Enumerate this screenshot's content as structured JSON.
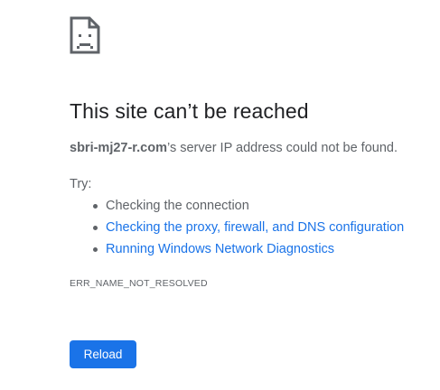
{
  "error": {
    "icon": "sad-document-icon",
    "title": "This site can’t be reached",
    "host": "sbri-mj27-r.com",
    "summary_suffix": "’s server IP address could not be found.",
    "try_label": "Try:",
    "suggestions": [
      {
        "label": "Checking the connection",
        "is_link": false
      },
      {
        "label": "Checking the proxy, firewall, and DNS configuration",
        "is_link": true
      },
      {
        "label": "Running Windows Network Diagnostics",
        "is_link": true
      }
    ],
    "code": "ERR_NAME_NOT_RESOLVED",
    "reload_label": "Reload"
  },
  "colors": {
    "link": "#1a73e8",
    "button": "#1a73e8",
    "text": "#202124",
    "secondary_text": "#5f6368"
  }
}
